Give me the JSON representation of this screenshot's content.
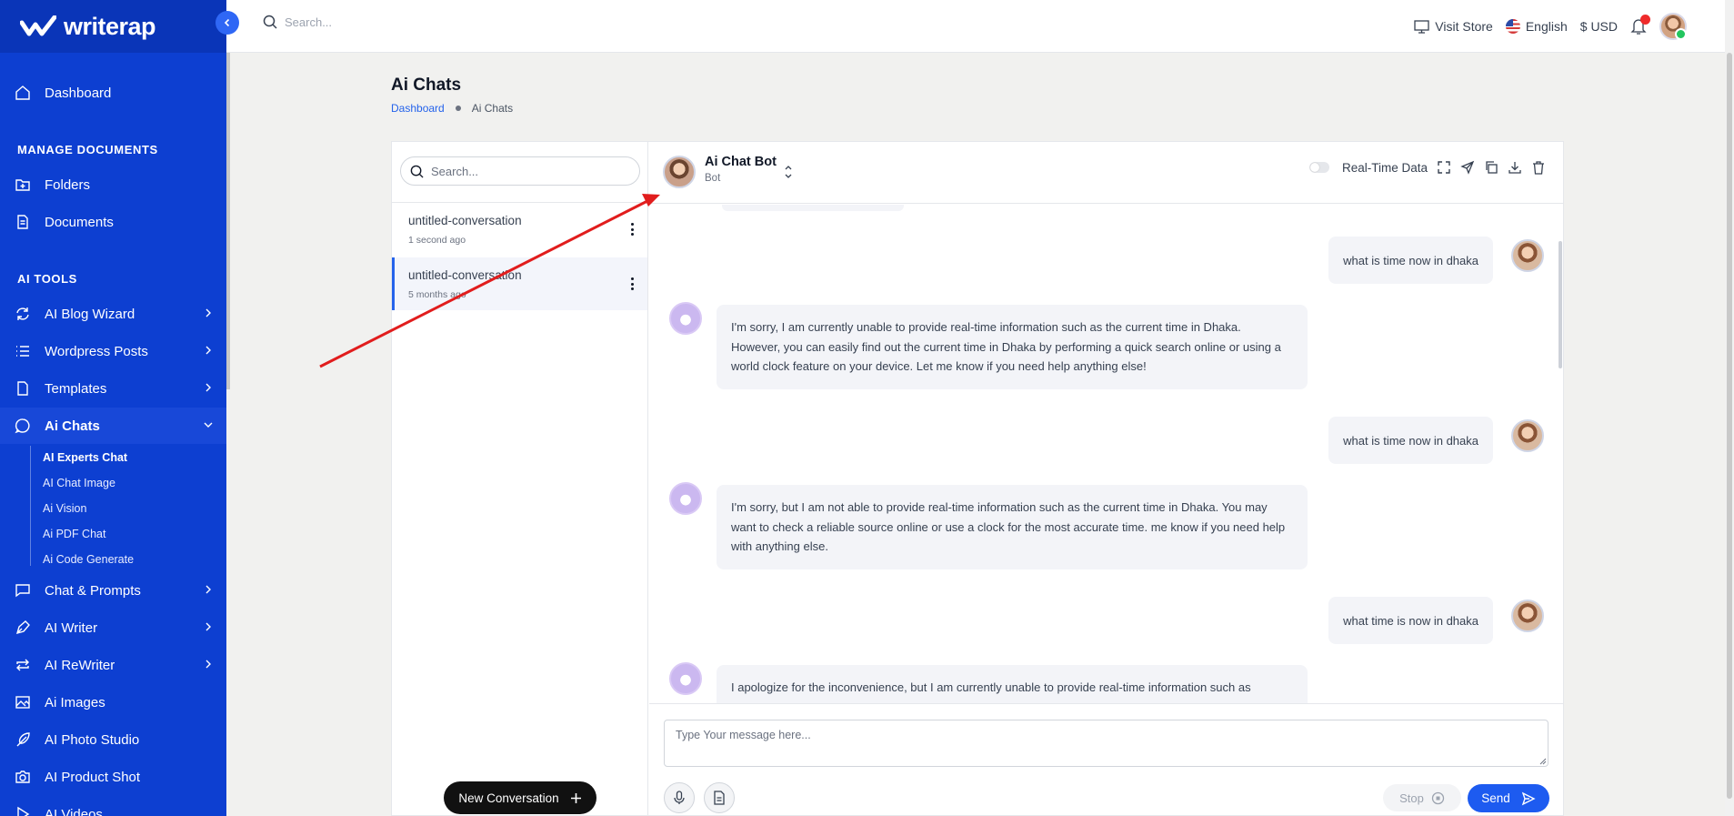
{
  "app": {
    "logo_text": "writerap"
  },
  "topbar": {
    "search_placeholder": "Search...",
    "visit_store": "Visit Store",
    "language": "English",
    "currency": "$ USD"
  },
  "sidebar": {
    "dashboard": "Dashboard",
    "section_manage": "MANAGE DOCUMENTS",
    "folders": "Folders",
    "documents": "Documents",
    "section_tools": "AI TOOLS",
    "blog_wizard": "AI Blog Wizard",
    "wordpress": "Wordpress Posts",
    "templates": "Templates",
    "ai_chats": "Ai Chats",
    "sub": [
      "AI Experts Chat",
      "AI Chat Image",
      "Ai Vision",
      "Ai PDF Chat",
      "Ai Code Generate"
    ],
    "chat_prompts": "Chat & Prompts",
    "ai_writer": "AI Writer",
    "ai_rewriter": "AI ReWriter",
    "ai_images": "Ai Images",
    "photo_studio": "AI Photo Studio",
    "product_shot": "AI Product Shot",
    "ai_videos": "AI Videos"
  },
  "page": {
    "title": "Ai Chats",
    "breadcrumb_home": "Dashboard",
    "breadcrumb_current": "Ai Chats"
  },
  "conversations": {
    "search_placeholder": "Search...",
    "items": [
      {
        "title": "untitled-conversation",
        "time": "1 second ago"
      },
      {
        "title": "untitled-conversation",
        "time": "5 months ago"
      }
    ],
    "new_button": "New Conversation"
  },
  "chat": {
    "bot_name": "Ai Chat Bot",
    "bot_role": "Bot",
    "realtime_label": "Real-Time Data",
    "messages": [
      {
        "role": "user",
        "text": "what is time now in dhaka"
      },
      {
        "role": "bot",
        "text": "I'm sorry, I am currently unable to provide real-time information such as the current time in Dhaka. However, you can easily find out the current time in Dhaka by performing a quick search online or using a world clock feature on your device. Let me know if you need help anything else!"
      },
      {
        "role": "user",
        "text": "what is time now in dhaka"
      },
      {
        "role": "bot",
        "text": "I'm sorry, but I am not able to provide real-time information such as the current time in Dhaka. You may want to check a reliable source online or use a clock for the most accurate time. me know if you need help with anything else."
      },
      {
        "role": "user",
        "text": "what time is now in dhaka"
      },
      {
        "role": "bot",
        "text": "I apologize for the inconvenience, but I am currently unable to provide real-time information such as"
      }
    ],
    "input_placeholder": "Type Your message here...",
    "stop_label": "Stop",
    "send_label": "Send"
  },
  "colors": {
    "sidebar": "#0d3fd1",
    "accent": "#1d5bf0",
    "annotation_arrow": "#e11d1d"
  }
}
